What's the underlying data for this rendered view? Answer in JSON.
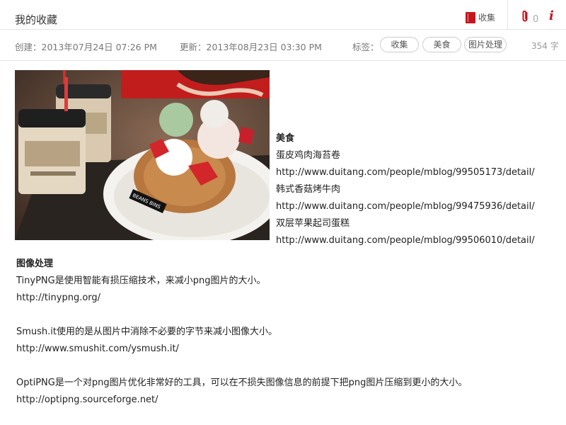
{
  "header": {
    "title": "我的收藏",
    "collect_label": "收集",
    "attach_count": "0"
  },
  "meta": {
    "created": "创建：2013年07月24日  07:26 PM",
    "updated": "更新：2013年08月23日 03:30 PM",
    "tags_label": "标签：",
    "tags": [
      "收集",
      "美食",
      "图片处理"
    ],
    "word_count": "354 字"
  },
  "food": {
    "heading": "美食",
    "lines": [
      "蛋皮鸡肉海苔卷",
      "http://www.duitang.com/people/mblog/99505173/detail/",
      "韩式香菇烤牛肉",
      "http://www.duitang.com/people/mblog/99475936/detail/",
      "双层苹果起司蛋糕",
      "http://www.duitang.com/people/mblog/99506010/detail/"
    ]
  },
  "imgproc": {
    "heading": "图像处理",
    "tinypng_desc": "TinyPNG是使用智能有损压缩技术，来减小png图片的大小。",
    "tinypng_url": "http://tinypng.org/",
    "smush_desc": "Smush.it使用的是从图片中消除不必要的字节来减小图像大小。",
    "smush_url": "http://www.smushit.com/ysmush.it/",
    "optipng_desc": "OptiPNG是一个对png图片优化非常好的工具，可以在不损失图像信息的前提下把png图片压缩到更小的大小。",
    "optipng_url": "http://optipng.sourceforge.net/"
  },
  "photo": {
    "box_text": "BEANS BINS"
  },
  "colors": {
    "accent": "#c4161c",
    "border": "#e3e3e3"
  }
}
